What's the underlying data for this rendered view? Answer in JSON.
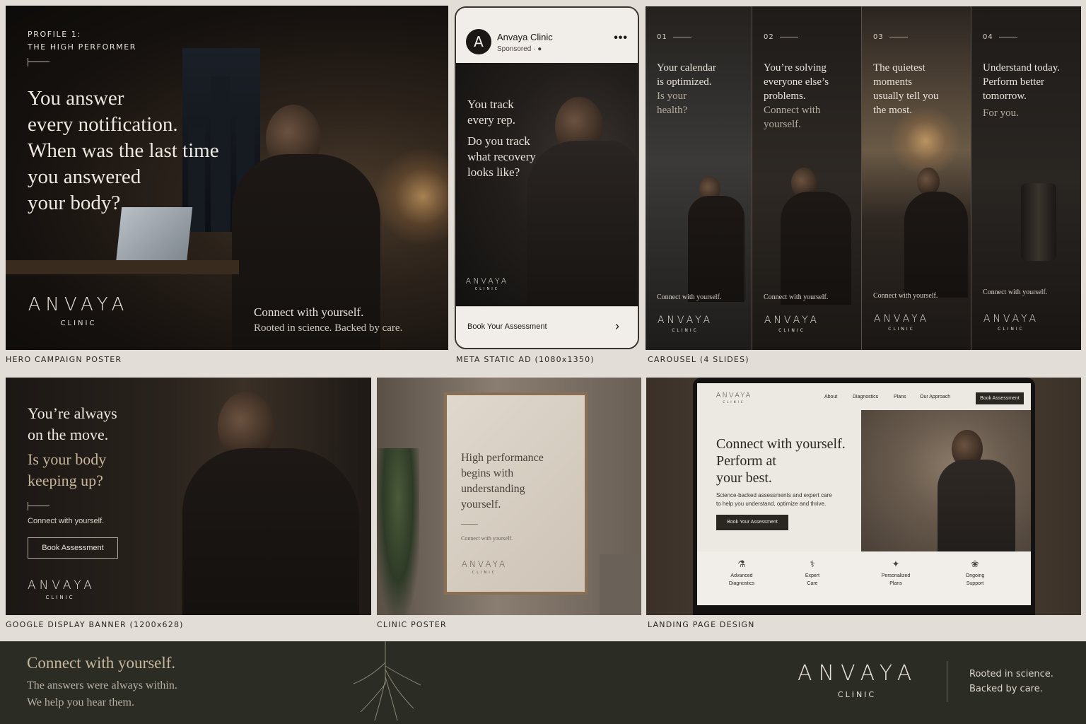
{
  "hero": {
    "eyebrow_1": "PROFILE 1:",
    "eyebrow_2": "THE HIGH PERFORMER",
    "headline": [
      "You answer",
      "every notification.",
      "When was the last time",
      "you answered",
      "your body?"
    ],
    "tagline_1": "Connect with yourself.",
    "tagline_2": "Rooted in science. Backed by care.",
    "caption": "HERO CAMPAIGN POSTER"
  },
  "brand": {
    "wordmark": "ANVAYA",
    "sub": "CLINIC"
  },
  "meta_ad": {
    "avatar_letter": "A",
    "page_name": "Anvaya Clinic",
    "sponsored": "Sponsored · ●",
    "more": "•••",
    "copy_1": [
      "You track",
      "every rep."
    ],
    "copy_2": [
      "Do you track",
      "what recovery",
      "looks like?"
    ],
    "cta": "Book Your Assessment",
    "chevron": "›",
    "caption": "META STATIC AD (1080x1350)"
  },
  "carousel": {
    "caption": "CAROUSEL (4 SLIDES)",
    "slides": [
      {
        "num": "01",
        "text": [
          "Your calendar",
          "is optimized."
        ],
        "dim": [
          "Is your",
          "health?"
        ],
        "tag": "Connect with yourself."
      },
      {
        "num": "02",
        "text": [
          "You’re solving",
          "everyone else’s",
          "problems."
        ],
        "dim": [
          "Connect with",
          "yourself."
        ],
        "tag": "Connect with yourself."
      },
      {
        "num": "03",
        "text": [
          "The quietest",
          "moments",
          "usually tell you",
          "the most."
        ],
        "dim": [],
        "tag": "Connect with yourself."
      },
      {
        "num": "04",
        "text": [
          "Understand today.",
          "Perform better",
          "tomorrow."
        ],
        "dim": [
          "For you."
        ],
        "tag": "Connect with yourself."
      }
    ]
  },
  "google": {
    "h1": [
      "You’re always",
      "on the move."
    ],
    "h2": [
      "Is your body",
      "keeping up?"
    ],
    "tag": "Connect with yourself.",
    "button": "Book Assessment",
    "caption": "GOOGLE DISPLAY BANNER (1200x628)"
  },
  "clinic_poster": {
    "text": [
      "High performance",
      "begins with",
      "understanding",
      "yourself."
    ],
    "tag": "Connect with yourself.",
    "caption": "CLINIC POSTER"
  },
  "landing": {
    "nav": [
      "About",
      "Diagnostics",
      "Plans",
      "Our Approach"
    ],
    "nav_button": "Book Assessment",
    "headline": [
      "Connect with yourself.",
      "Perform at",
      "your best."
    ],
    "sub": [
      "Science-backed assessments and expert care",
      "to help you understand, optimize and thrive."
    ],
    "button": "Book Your Assessment",
    "features": [
      {
        "icon": "flask-icon",
        "glyph": "⚗",
        "label": [
          "Advanced",
          "Diagnostics"
        ]
      },
      {
        "icon": "stethoscope-icon",
        "glyph": "⚕",
        "label": [
          "Expert",
          "Care"
        ]
      },
      {
        "icon": "plan-icon",
        "glyph": "✦",
        "label": [
          "Personalized",
          "Plans"
        ]
      },
      {
        "icon": "support-icon",
        "glyph": "❀",
        "label": [
          "Ongoing",
          "Support"
        ]
      }
    ],
    "caption": "LANDING PAGE DESIGN"
  },
  "footer": {
    "h1": "Connect with yourself.",
    "sub_1": "The answers were always within.",
    "sub_2": "We help you hear them.",
    "tag_1": "Rooted in science.",
    "tag_2": "Backed by care."
  },
  "colors": {
    "background": "#e3ddd7",
    "footer": "#2b2d24",
    "accent": "#c8b69b",
    "dark": "#15110e"
  }
}
